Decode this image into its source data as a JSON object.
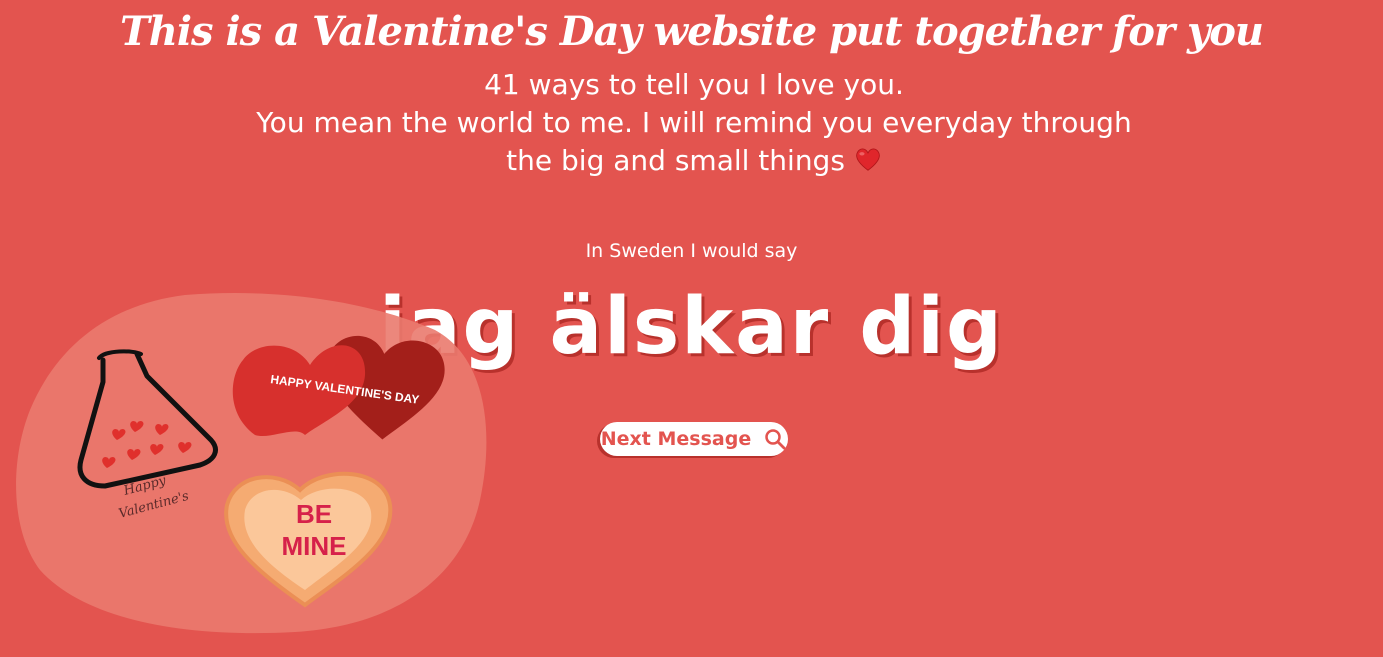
{
  "header": {
    "title": "This is a Valentine's Day website put together for you"
  },
  "intro": {
    "line1": "41 ways to tell you I love you.",
    "line2": "You mean the world to me. I will remind you everyday through the big and small things",
    "emoji": "heart-emoji"
  },
  "message": {
    "country_line": "In Sweden I would say",
    "phrase": "jag älskar dig"
  },
  "button": {
    "next_label": "Next Message",
    "icon": "search-icon"
  },
  "illustration": {
    "heart_text": "HAPPY VALENTINE'S DAY",
    "candy_text_line1": "BE",
    "candy_text_line2": "MINE",
    "flask_text_line1": "Happy",
    "flask_text_line2": "Valentine's"
  },
  "colors": {
    "background": "#e3544f",
    "shadow": "#b8312c",
    "text": "#ffffff"
  }
}
